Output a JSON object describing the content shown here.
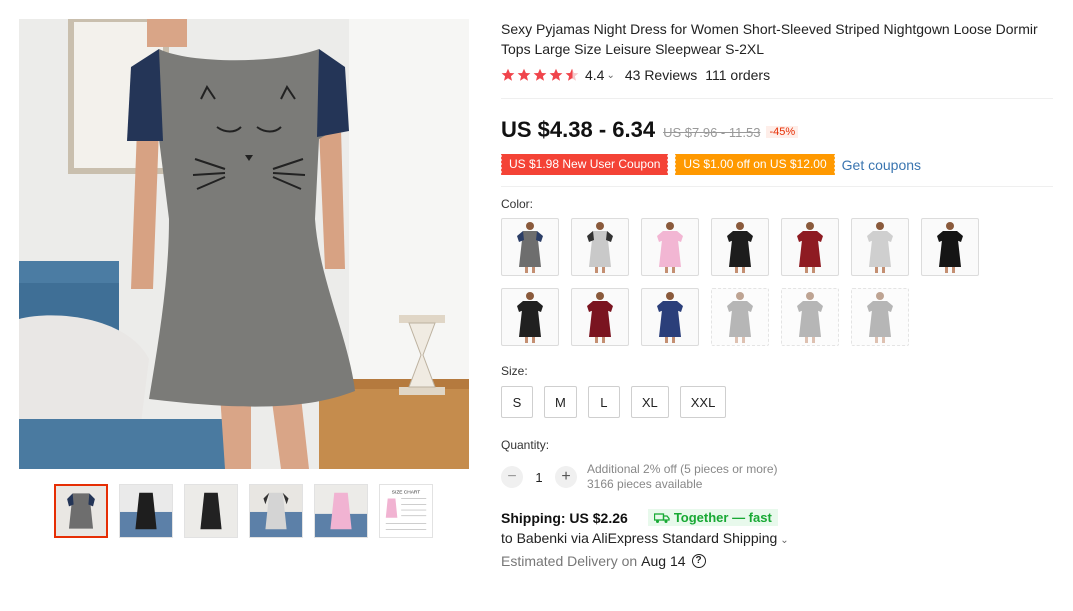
{
  "product": {
    "title": "Sexy Pyjamas Night Dress for Women Short-Sleeved Striped Nightgown Loose Dormir Tops Large Size Leisure Sleepwear S-2XL",
    "rating": {
      "score": "4.4",
      "stars": 4.5,
      "reviews": "43 Reviews",
      "orders": "111 orders"
    }
  },
  "price": {
    "current": "US $4.38 - 6.34",
    "original": "US $7.96 - 11.53",
    "discount": "-45%"
  },
  "coupons": {
    "new_user": "US $1.98 New User Coupon",
    "store": "US $1.00 off on US $12.00",
    "get_link": "Get coupons"
  },
  "color": {
    "label": "Color:",
    "swatches": [
      {
        "name": "gray-navy-cat",
        "color": "#6e6e6e",
        "accent": "#2c3e66",
        "available": true
      },
      {
        "name": "light-gray-black",
        "color": "#c9c9c9",
        "accent": "#333333",
        "available": true
      },
      {
        "name": "pink",
        "color": "#f2b6d3",
        "accent": "#f2b6d3",
        "available": true
      },
      {
        "name": "black",
        "color": "#1d1d1d",
        "accent": "#1d1d1d",
        "available": true
      },
      {
        "name": "wine-red",
        "color": "#8e1b22",
        "accent": "#8e1b22",
        "available": true
      },
      {
        "name": "light-gray",
        "color": "#cfcfcf",
        "accent": "#cfcfcf",
        "available": true
      },
      {
        "name": "black-print",
        "color": "#151515",
        "accent": "#151515",
        "available": true
      },
      {
        "name": "black-2",
        "color": "#202020",
        "accent": "#202020",
        "available": true
      },
      {
        "name": "burgundy",
        "color": "#7a1420",
        "accent": "#7a1420",
        "available": true
      },
      {
        "name": "navy-blue",
        "color": "#2b3f7a",
        "accent": "#2b3f7a",
        "available": true
      },
      {
        "name": "gray-1",
        "color": "#7b7b7b",
        "accent": "#7b7b7b",
        "available": false
      },
      {
        "name": "gray-2",
        "color": "#7b7b7b",
        "accent": "#7b7b7b",
        "available": false
      },
      {
        "name": "gray-3",
        "color": "#7b7b7b",
        "accent": "#7b7b7b",
        "available": false
      }
    ]
  },
  "size": {
    "label": "Size:",
    "options": [
      "S",
      "M",
      "L",
      "XL",
      "XXL"
    ]
  },
  "quantity": {
    "label": "Quantity:",
    "value": "1",
    "minus": "−",
    "plus": "+",
    "note_discount": "Additional 2% off (5 pieces or more)",
    "note_available": "3166 pieces available"
  },
  "shipping": {
    "title": "Shipping: US $2.26",
    "badge": "Together — fast",
    "via": "to Babenki via AliExpress Standard Shipping",
    "delivery_label": "Estimated Delivery on",
    "delivery_date": "Aug 14",
    "help": "?"
  },
  "thumbnails": [
    {
      "name": "gray-navy-cat",
      "color": "#6e6e6e",
      "active": true
    },
    {
      "name": "black-print",
      "color": "#1e1e1e",
      "active": false
    },
    {
      "name": "black",
      "color": "#222222",
      "active": false
    },
    {
      "name": "light-gray",
      "color": "#d4d4d4",
      "active": false
    },
    {
      "name": "pink",
      "color": "#f1b3d2",
      "active": false
    },
    {
      "name": "size-chart",
      "color": "#ffffff",
      "active": false,
      "text": "SIZE CHART"
    }
  ],
  "colors": {
    "accent_red": "#e62e04",
    "star": "#f0444b",
    "link": "#3a75b0",
    "fast_green": "#18a934"
  }
}
